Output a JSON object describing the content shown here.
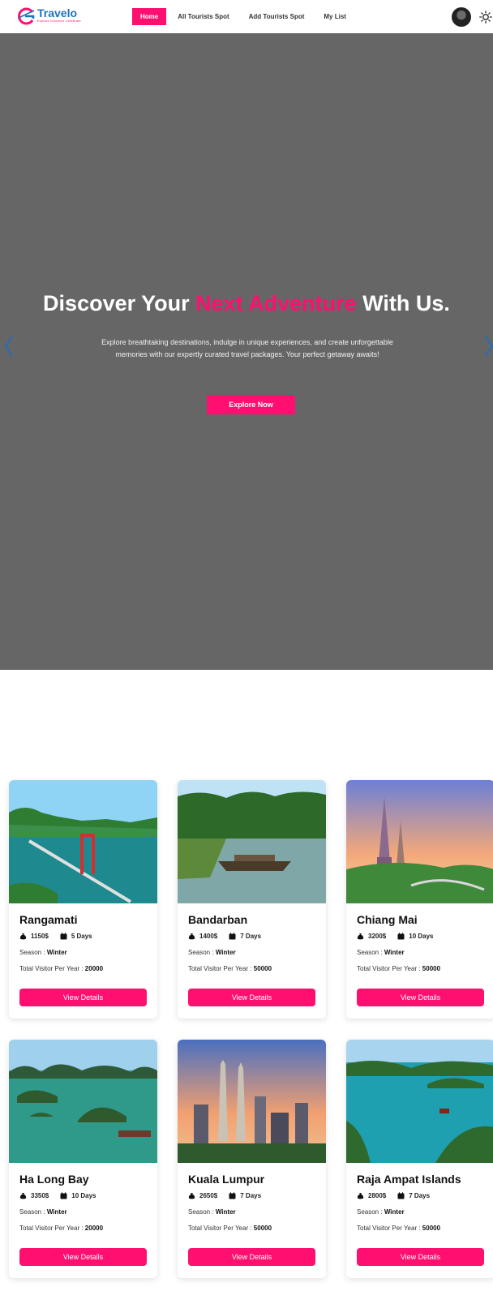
{
  "brand": {
    "name": "Travelo",
    "tagline": "Explore Discover Celebrate",
    "accent": "#ff0f6f",
    "logo_color": "#1e73be"
  },
  "nav": {
    "items": [
      {
        "label": "Home",
        "active": true
      },
      {
        "label": "All Tourists Spot",
        "active": false
      },
      {
        "label": "Add Tourists Spot",
        "active": false
      },
      {
        "label": "My List",
        "active": false
      }
    ],
    "avatar_icon": "user-avatar",
    "theme_icon": "sun-icon"
  },
  "hero": {
    "title_start": "Discover Your ",
    "title_accent": "Next Adventure",
    "title_end": " With Us.",
    "description": "Explore breathtaking destinations, indulge in unique experiences, and create unforgettable memories with our expertly curated travel packages. Your perfect getaway awaits!",
    "cta": "Explore Now",
    "background": "#666666"
  },
  "spots": [
    {
      "name": "Rangamati",
      "cost": "1150$",
      "duration": "5 Days",
      "season_label": "Season : ",
      "season": "Winter",
      "visitors_label": "Total Visitor Per Year : ",
      "visitors": "20000",
      "button": "View Details"
    },
    {
      "name": "Bandarban",
      "cost": "1400$",
      "duration": "7 Days",
      "season_label": "Season : ",
      "season": "Winter",
      "visitors_label": "Total Visitor Per Year : ",
      "visitors": "50000",
      "button": "View Details"
    },
    {
      "name": "Chiang Mai",
      "cost": "3200$",
      "duration": "10 Days",
      "season_label": "Season : ",
      "season": "Winter",
      "visitors_label": "Total Visitor Per Year : ",
      "visitors": "50000",
      "button": "View Details"
    },
    {
      "name": "Ha Long Bay",
      "cost": "3350$",
      "duration": "10 Days",
      "season_label": "Season : ",
      "season": "Winter",
      "visitors_label": "Total Visitor Per Year : ",
      "visitors": "20000",
      "button": "View Details"
    },
    {
      "name": "Kuala Lumpur",
      "cost": "2650$",
      "duration": "7 Days",
      "season_label": "Season : ",
      "season": "Winter",
      "visitors_label": "Total Visitor Per Year : ",
      "visitors": "50000",
      "button": "View Details"
    },
    {
      "name": "Raja Ampat Islands",
      "cost": "2800$",
      "duration": "7 Days",
      "season_label": "Season : ",
      "season": "Winter",
      "visitors_label": "Total Visitor Per Year : ",
      "visitors": "50000",
      "button": "View Details"
    }
  ]
}
